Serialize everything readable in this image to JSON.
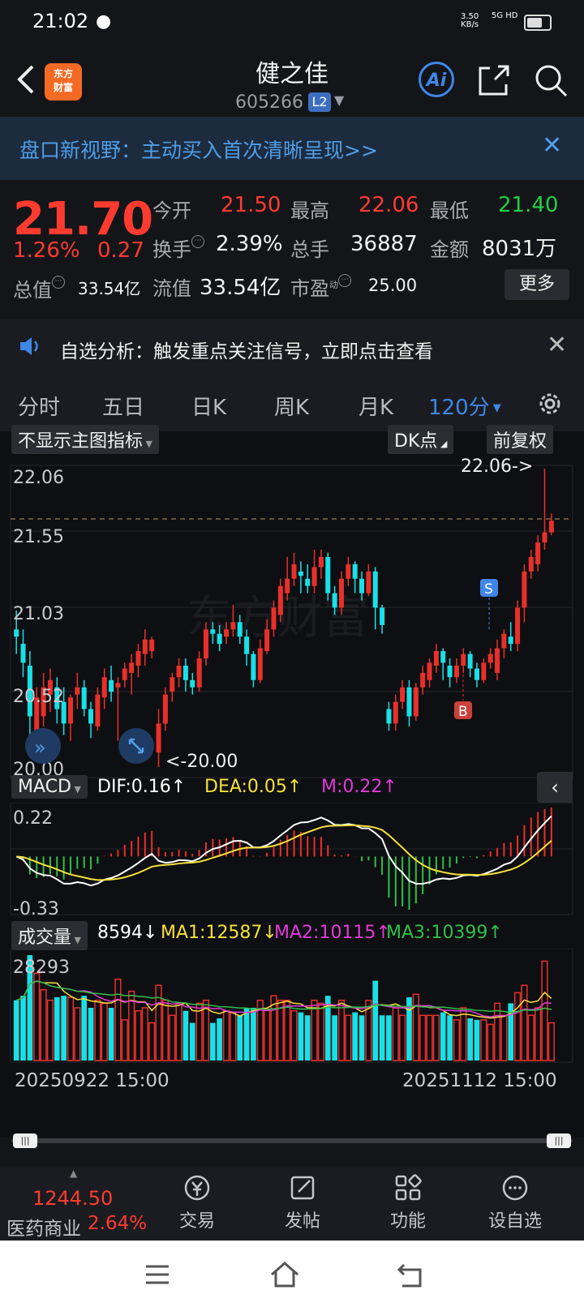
{
  "status_bar": {
    "time": "21:02",
    "net_speed": "3.50",
    "net_unit": "KB/s",
    "signal": "5G HD"
  },
  "header": {
    "stock_name": "健之佳",
    "stock_code": "605266",
    "level_badge": "L2",
    "logo_line1": "东方",
    "logo_line2": "财富",
    "ai_label": "Ai"
  },
  "banner": {
    "text": "盘口新视野：主动买入首次清晰呈现>>"
  },
  "quote": {
    "price": "21.70",
    "change_pct": "1.26%",
    "change_abs": "0.27",
    "open_label": "今开",
    "open": "21.50",
    "high_label": "最高",
    "high": "22.06",
    "low_label": "最低",
    "low": "21.40",
    "turnover_label": "换手",
    "turnover": "2.39%",
    "volume_label": "总手",
    "volume": "36887",
    "amount_label": "金额",
    "amount": "8031万",
    "total_cap_label": "总值",
    "total_cap": "33.54亿",
    "float_cap_label": "流值",
    "float_cap": "33.54亿",
    "pe_label": "市盈",
    "pe_sup": "动",
    "pe": "25.00",
    "more_label": "更多"
  },
  "notice": {
    "text": "自选分析：触发重点关注信号，立即点击查看"
  },
  "tabs": [
    {
      "label": "分时"
    },
    {
      "label": "五日"
    },
    {
      "label": "日K"
    },
    {
      "label": "周K"
    },
    {
      "label": "月K"
    },
    {
      "label": "120分"
    }
  ],
  "chart": {
    "indicator_selector": "不显示主图指标",
    "dk_label": "DK点",
    "adjust_label": "前复权",
    "y_labels": [
      "22.06",
      "21.55",
      "21.03",
      "20.52",
      "20.00"
    ],
    "high_marker": "22.06->",
    "low_marker": "<-20.00",
    "sell_marker": "S",
    "buy_marker": "B",
    "watermark": "东方财富",
    "macd": {
      "name": "MACD",
      "dif": "DIF:0.16↑",
      "dea": "DEA:0.05↑",
      "m": "M:0.22↑",
      "y_top": "0.22",
      "y_bottom": "-0.33"
    },
    "volume": {
      "name": "成交量",
      "value": "8594↓",
      "ma1": "MA1:12587↓",
      "ma2": "MA2:10115↑",
      "ma3": "MA3:10399↑",
      "y_top": "28293"
    },
    "date_start": "20250922 15:00",
    "date_end": "20251112 15:00",
    "colors": {
      "up": "#e8302b",
      "down": "#19e0e6",
      "dif": "#ffffff",
      "dea": "#f5e13a",
      "m": "#e03ad8",
      "ma3": "#2fbf4a"
    }
  },
  "chart_data": {
    "type": "candlestick",
    "ylim": [
      20.0,
      22.06
    ],
    "candles": [
      [
        20.95,
        20.9,
        21.08,
        20.78
      ],
      [
        20.85,
        20.72,
        20.95,
        20.62
      ],
      [
        20.7,
        20.35,
        20.8,
        20.2
      ],
      [
        20.2,
        20.48,
        20.55,
        20.15
      ],
      [
        20.35,
        20.55,
        20.65,
        20.28
      ],
      [
        20.5,
        20.6,
        20.68,
        20.38
      ],
      [
        20.55,
        20.4,
        20.62,
        20.3
      ],
      [
        20.45,
        20.3,
        20.55,
        20.22
      ],
      [
        20.3,
        20.48,
        20.5,
        20.18
      ],
      [
        20.5,
        20.55,
        20.65,
        20.4
      ],
      [
        20.55,
        20.4,
        20.6,
        20.35
      ],
      [
        20.4,
        20.3,
        20.45,
        20.2
      ],
      [
        20.28,
        20.5,
        20.55,
        20.25
      ],
      [
        20.48,
        20.62,
        20.68,
        20.4
      ],
      [
        20.6,
        20.52,
        20.7,
        20.45
      ],
      [
        20.55,
        20.58,
        20.62,
        20.18
      ],
      [
        20.6,
        20.68,
        20.72,
        20.55
      ],
      [
        20.65,
        20.72,
        20.78,
        20.5
      ],
      [
        20.7,
        20.8,
        20.85,
        20.62
      ],
      [
        20.78,
        20.88,
        20.95,
        20.7
      ],
      [
        20.8,
        20.88,
        20.9,
        20.75
      ],
      [
        20.1,
        20.3,
        20.4,
        20.0
      ],
      [
        20.3,
        20.5,
        20.55,
        20.25
      ],
      [
        20.52,
        20.62,
        20.65,
        20.45
      ],
      [
        20.62,
        20.7,
        20.75,
        20.55
      ],
      [
        20.7,
        20.6,
        20.75,
        20.52
      ],
      [
        20.6,
        20.55,
        20.65,
        20.5
      ],
      [
        20.55,
        20.75,
        20.8,
        20.52
      ],
      [
        20.75,
        20.95,
        21.0,
        20.7
      ],
      [
        20.95,
        20.92,
        21.0,
        20.85
      ],
      [
        20.92,
        20.85,
        20.98,
        20.8
      ],
      [
        20.9,
        20.95,
        21.0,
        20.85
      ],
      [
        20.95,
        21.0,
        21.12,
        20.9
      ],
      [
        21.0,
        20.9,
        21.05,
        20.85
      ],
      [
        20.9,
        20.78,
        20.95,
        20.7
      ],
      [
        20.78,
        20.6,
        20.8,
        20.55
      ],
      [
        20.6,
        20.82,
        20.88,
        20.58
      ],
      [
        20.8,
        20.95,
        21.02,
        20.78
      ],
      [
        20.95,
        21.1,
        21.15,
        20.9
      ],
      [
        21.05,
        21.25,
        21.3,
        21.0
      ],
      [
        21.2,
        21.3,
        21.45,
        21.15
      ],
      [
        21.3,
        21.4,
        21.48,
        21.25
      ],
      [
        21.35,
        21.32,
        21.42,
        21.2
      ],
      [
        21.3,
        21.25,
        21.4,
        21.2
      ],
      [
        21.25,
        21.38,
        21.5,
        21.2
      ],
      [
        21.38,
        21.45,
        21.5,
        21.3
      ],
      [
        21.45,
        21.2,
        21.48,
        21.15
      ],
      [
        21.2,
        21.1,
        21.25,
        21.05
      ],
      [
        21.1,
        21.3,
        21.35,
        21.05
      ],
      [
        21.3,
        21.4,
        21.45,
        21.25
      ],
      [
        21.4,
        21.3,
        21.42,
        21.2
      ],
      [
        21.3,
        21.2,
        21.35,
        21.15
      ],
      [
        21.2,
        21.35,
        21.4,
        21.18
      ],
      [
        21.35,
        21.1,
        21.38,
        20.95
      ],
      [
        21.1,
        20.98,
        21.12,
        20.92
      ],
      [
        20.4,
        20.3,
        20.45,
        20.25
      ],
      [
        20.3,
        20.45,
        20.5,
        20.25
      ],
      [
        20.45,
        20.55,
        20.6,
        20.4
      ],
      [
        20.55,
        20.35,
        20.6,
        20.28
      ],
      [
        20.35,
        20.55,
        20.58,
        20.32
      ],
      [
        20.55,
        20.65,
        20.7,
        20.5
      ],
      [
        20.6,
        20.72,
        20.75,
        20.55
      ],
      [
        20.7,
        20.8,
        20.85,
        20.65
      ],
      [
        20.8,
        20.72,
        20.82,
        20.6
      ],
      [
        20.7,
        20.62,
        20.75,
        20.55
      ],
      [
        20.62,
        20.7,
        20.75,
        20.58
      ],
      [
        20.7,
        20.78,
        20.82,
        20.65
      ],
      [
        20.78,
        20.68,
        20.8,
        20.62
      ],
      [
        20.68,
        20.6,
        20.72,
        20.55
      ],
      [
        20.6,
        20.72,
        20.75,
        20.58
      ],
      [
        20.72,
        20.78,
        20.82,
        20.68
      ],
      [
        20.65,
        20.82,
        20.88,
        20.6
      ],
      [
        20.82,
        20.92,
        20.95,
        20.75
      ],
      [
        20.9,
        20.85,
        21.0,
        20.8
      ],
      [
        20.85,
        21.1,
        21.15,
        20.8
      ],
      [
        21.1,
        21.35,
        21.4,
        21.0
      ],
      [
        21.35,
        21.45,
        21.5,
        21.3
      ],
      [
        21.4,
        21.55,
        21.6,
        21.35
      ],
      [
        21.55,
        21.62,
        22.06,
        21.5
      ],
      [
        21.62,
        21.7,
        21.75,
        21.6
      ]
    ]
  }
}
